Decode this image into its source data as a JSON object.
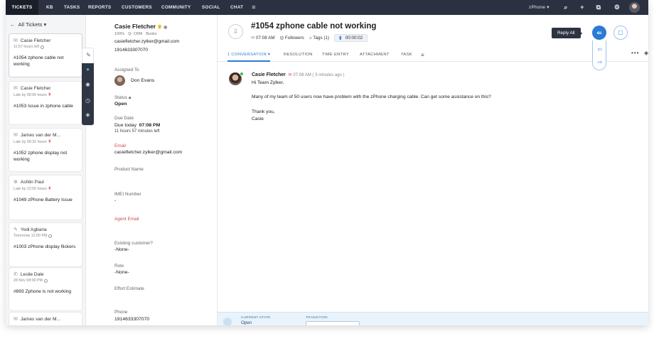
{
  "nav": {
    "tabs": [
      "TICKETS",
      "KB",
      "TASKS",
      "REPORTS",
      "CUSTOMERS",
      "COMMUNITY",
      "SOCIAL",
      "CHAT"
    ],
    "org": "zPhone ▾"
  },
  "ticket_list": {
    "view": "All Tickets",
    "cards": [
      {
        "name": "Casie Fletcher",
        "status": "11:57 hours left",
        "title": "#1054  zphone cable not working"
      },
      {
        "name": "Casie Fletcher",
        "status": "Late by 09:00 hours",
        "title": "#1053  Issue in zphone cable"
      },
      {
        "name": "James van der M...",
        "status": "Late by 09:32 hours",
        "title": "#1052  zphone display not working"
      },
      {
        "name": "Ashlin Paul",
        "status": "Late by 12:00 hours",
        "title": "#1049  zPhone Battery Issue"
      },
      {
        "name": "Yodi Agbaria",
        "status": "Tomorrow 12:00 PM",
        "title": "#1003  zPhone display flickers"
      },
      {
        "name": "Leslie Dale",
        "status": "28 Nov 08:00 PM",
        "title": "#893  Zphone is not working"
      },
      {
        "name": "James van der M...",
        "status": "",
        "title": ""
      }
    ]
  },
  "contact": {
    "name": "Casie Fletcher",
    "tags": [
      "100%",
      "Q- CRM",
      "Books"
    ],
    "email": "casiefletcher.zylker@gmail.com",
    "phone": "1914633307070",
    "assigned_label": "Assigned To",
    "assignee": "Don Evans",
    "status_label": "Status",
    "status": "Open",
    "due_label": "Due Date",
    "due_prefix": "Due today",
    "due_time": "07:08 PM",
    "due_left": "11 hours 57 minutes left",
    "email_label": "Email",
    "email_value": "casiefletcher.zylker@gmail.com",
    "product_label": "Product Name",
    "imei_label": "IMEI Number",
    "imei_value": "-",
    "agent_email_label": "Agent Email",
    "existing_label": "Existing customer?",
    "existing_value": "-None-",
    "role_label": "Role",
    "role_value": "-None-",
    "effort_label": "Effort Estimate",
    "phone_label": "Phone",
    "phone_value": "1914633307070"
  },
  "ticket": {
    "title": "#1054  zphone cable not working",
    "time": "07:08 AM",
    "followers": "Followers",
    "tags": "Tags (1)",
    "timer": "00:00:02",
    "subtabs": [
      "1 CONVERSATION ▾",
      "RESOLUTION",
      "TIME ENTRY",
      "ATTACHMENT",
      "TASK"
    ],
    "reply_all": "Reply All",
    "message": {
      "from": "Casie Fletcher",
      "time": "07:08 AM ( 3 minutes ago )",
      "greeting": "Hi Team Zylker,",
      "body": "Many of my team of 50 users now have problem with the zPhone charging cable. Can get some assistance on this?",
      "closing": "Thank you,",
      "signature": "Casie"
    },
    "blueprint": {
      "current_state_label": "CURRENT STATE",
      "transition_label": "TRANSITION",
      "state": "Open"
    }
  },
  "colors": {
    "nav_bg": "#2b3140",
    "accent": "#2a7bd4",
    "alert": "#e05252"
  }
}
